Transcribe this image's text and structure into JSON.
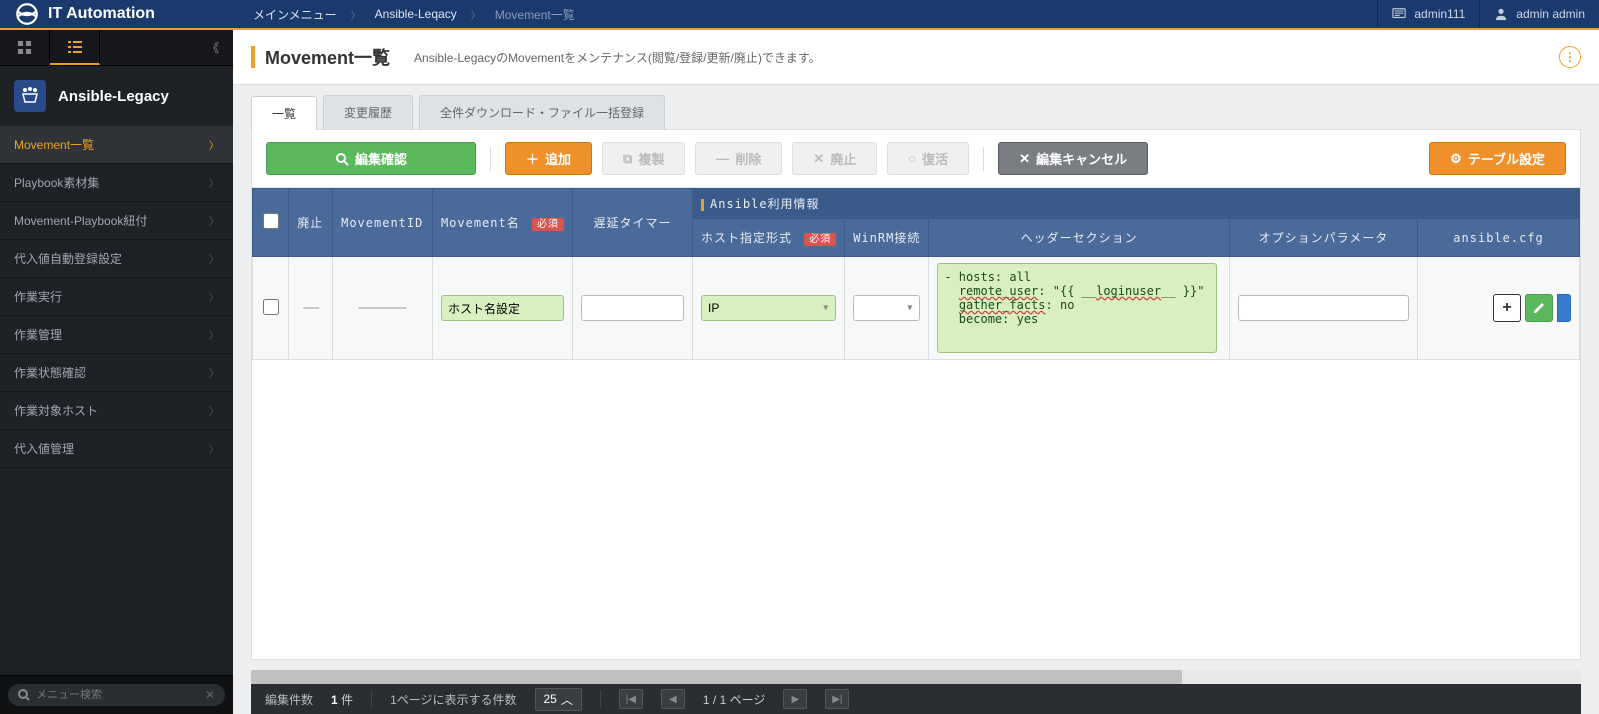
{
  "header": {
    "logo_text": "IT Automation",
    "breadcrumb": [
      "メインメニュー",
      "Ansible-Leqacy",
      "Movement一覧"
    ],
    "user1": "admin111",
    "user2": "admin admin"
  },
  "sidebar": {
    "title": "Ansible-Legacy",
    "items": [
      {
        "label": "Movement一覧",
        "active": true
      },
      {
        "label": "Playbook素材集",
        "active": false
      },
      {
        "label": "Movement-Playbook紐付",
        "active": false
      },
      {
        "label": "代入値自動登録設定",
        "active": false
      },
      {
        "label": "作業実行",
        "active": false
      },
      {
        "label": "作業管理",
        "active": false
      },
      {
        "label": "作業状態確認",
        "active": false
      },
      {
        "label": "作業対象ホスト",
        "active": false
      },
      {
        "label": "代入値管理",
        "active": false
      }
    ],
    "search_placeholder": "メニュー検索"
  },
  "page": {
    "title": "Movement一覧",
    "desc": "Ansible-LegacyのMovementをメンテナンス(閲覧/登録/更新/廃止)できます。"
  },
  "tabs": [
    {
      "label": "一覧",
      "active": true
    },
    {
      "label": "変更履歴",
      "active": false
    },
    {
      "label": "全件ダウンロード・ファイル一括登録",
      "active": false
    }
  ],
  "toolbar": {
    "confirm": "編集確認",
    "add": "追加",
    "copy": "複製",
    "delete": "削除",
    "abolish": "廃止",
    "restore": "復活",
    "cancel": "編集キャンセル",
    "table_settings": "テーブル設定"
  },
  "table": {
    "group_header": "Ansible利用情報",
    "headers": {
      "abolish": "廃止",
      "movement_id": "MovementID",
      "movement_name": "Movement名",
      "required": "必須",
      "delay_timer": "遅延タイマー",
      "host_format": "ホスト指定形式",
      "winrm": "WinRM接続",
      "header_section": "ヘッダーセクション",
      "option_param": "オプションパラメータ",
      "ansible_cfg": "ansible.cfg"
    },
    "row": {
      "movement_name_value": "ホスト名設定",
      "host_format_value": "IP",
      "header_section_value": "- hosts: all\n  remote_user: \"{{ __loginuser__ }}\"\n  gather_facts: no\n  become: yes"
    }
  },
  "footer": {
    "edit_count_label": "編集件数",
    "edit_count_value": "1",
    "edit_count_unit": "件",
    "per_page_label": "1ページに表示する件数",
    "per_page_value": "25",
    "page_current": "1",
    "page_sep": "/",
    "page_total": "1 ページ"
  }
}
